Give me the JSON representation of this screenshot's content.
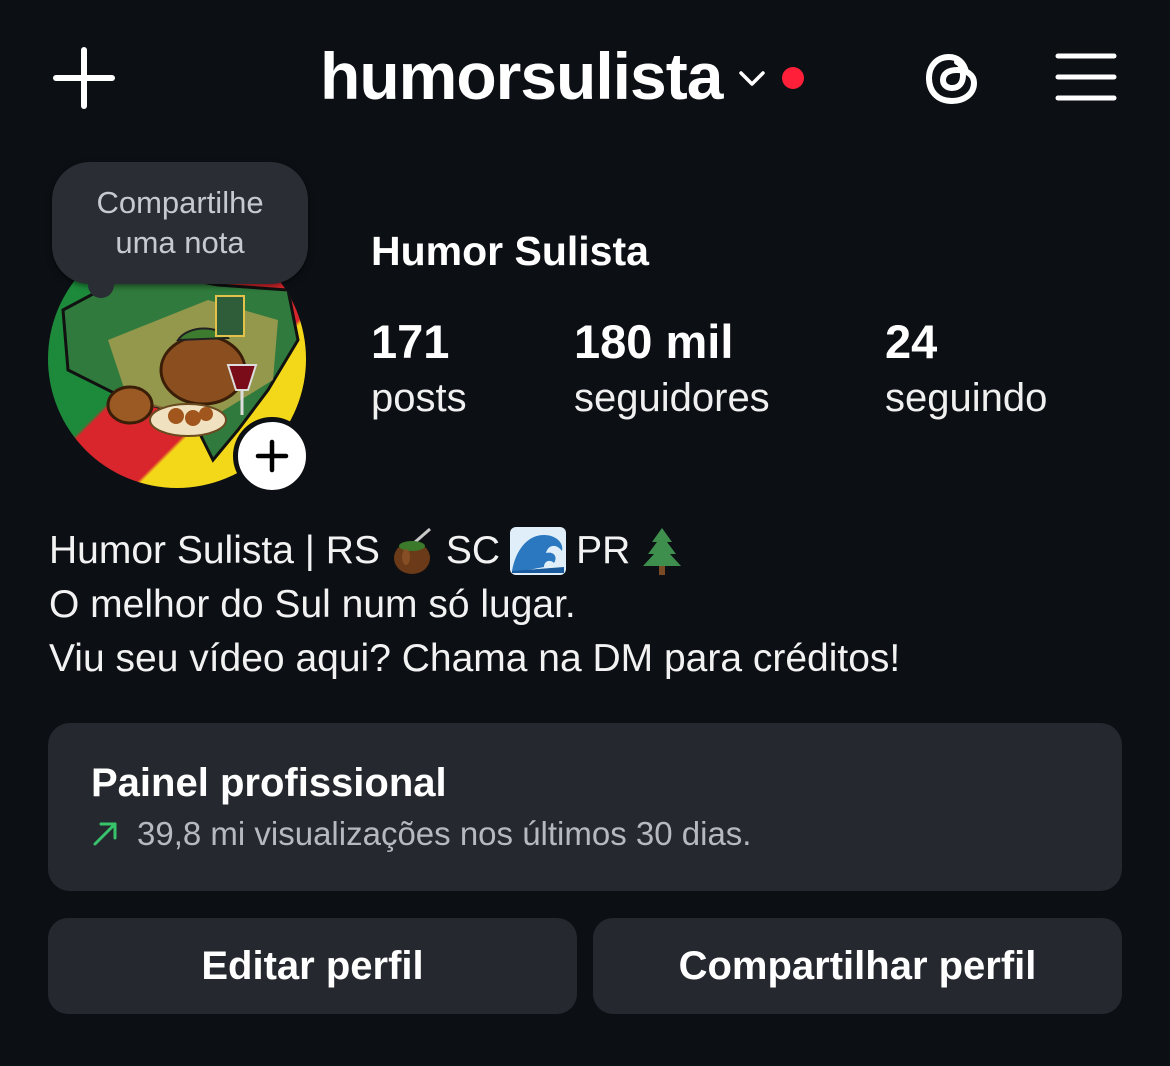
{
  "header": {
    "username": "humorsulista",
    "create_icon": "plus-icon",
    "threads_icon": "threads-icon",
    "menu_icon": "hamburger-menu-icon",
    "notification_dot_color": "#ff1f38"
  },
  "profile": {
    "note_placeholder": "Compartilhe uma nota",
    "note_line1": "Compartilhe",
    "note_line2": "uma nota",
    "display_name": "Humor Sulista",
    "stats": {
      "posts": {
        "value": "171",
        "label": "posts"
      },
      "followers": {
        "value": "180 mil",
        "label": "seguidores"
      },
      "following": {
        "value": "24",
        "label": "seguindo"
      }
    },
    "bio": {
      "line1_a": "Humor Sulista | RS",
      "line1_b": "SC",
      "line1_c": "PR",
      "line1_emojis": [
        "mate-cuia-emoji",
        "wave-emoji",
        "evergreen-tree-emoji"
      ],
      "line2": "O melhor do Sul num só lugar.",
      "line3": "Viu seu vídeo aqui? Chama na DM para créditos!"
    }
  },
  "professional_dashboard": {
    "title": "Painel profissional",
    "subtitle": "39,8 mi visualizações nos últimos 30 dias.",
    "trend_icon": "trending-up-arrow-icon",
    "trend_color": "#37c46b"
  },
  "actions": {
    "edit_profile": "Editar perfil",
    "share_profile": "Compartilhar perfil"
  }
}
